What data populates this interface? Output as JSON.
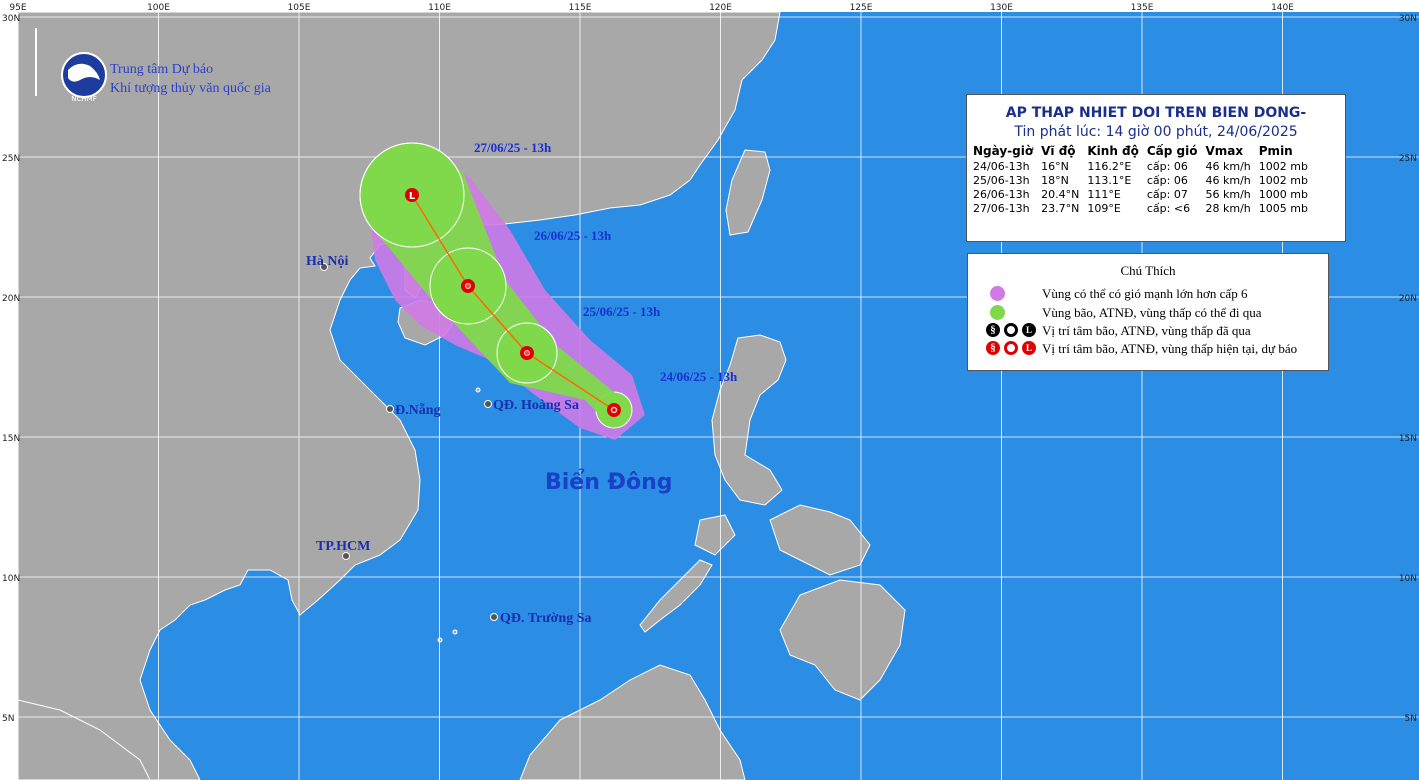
{
  "map": {
    "colors": {
      "sea": "#2b8de3",
      "land": "#a8a8a8",
      "land_border": "#ffffff",
      "grid": "#ffffff",
      "track": "#ff6a00",
      "cone": "#d07ae6",
      "storm_area": "#7fd94a",
      "center": "#e10000"
    },
    "lon_ticks": [
      "95E",
      "100E",
      "105E",
      "110E",
      "115E",
      "120E",
      "125E",
      "130E",
      "135E",
      "140E"
    ],
    "lat_ticks": [
      "30N",
      "25N",
      "20N",
      "15N",
      "10N",
      "5N"
    ],
    "agency": {
      "line1": "Trung tâm Dự báo",
      "line2": "Khí tượng thủy văn quốc gia",
      "logo_text": "NCHMF",
      "logo_icon": "nchmf-logo-icon"
    },
    "places": [
      {
        "id": "hanoi",
        "label": "Hà Nội"
      },
      {
        "id": "danang",
        "label": "Đ.Nẵng"
      },
      {
        "id": "hoangsa",
        "label": "QĐ. Hoàng Sa"
      },
      {
        "id": "hcm",
        "label": "TP.HCM"
      },
      {
        "id": "truongsa",
        "label": "QĐ. Trường Sa"
      }
    ],
    "sea_label": "Biển Đông",
    "track_labels": [
      "24/06/25 - 13h",
      "25/06/25 - 13h",
      "26/06/25 - 13h",
      "27/06/25 - 13h"
    ],
    "final_symbol": "L"
  },
  "info": {
    "title": "AP THAP NHIET DOI TREN BIEN DONG-",
    "issued": "Tin phát lúc: 14 giờ 00 phút, 24/06/2025",
    "headers": [
      "Ngày-giờ",
      "Vĩ độ",
      "Kinh độ",
      "Cấp gió",
      "Vmax",
      "Pmin"
    ],
    "rows": [
      [
        "24/06-13h",
        "16°N",
        "116.2°E",
        "cấp: 06",
        "46 km/h",
        "1002 mb"
      ],
      [
        "25/06-13h",
        "18°N",
        "113.1°E",
        "cấp: 06",
        "46 km/h",
        "1002 mb"
      ],
      [
        "26/06-13h",
        "20.4°N",
        "111°E",
        "cấp: 07",
        "56 km/h",
        "1000 mb"
      ],
      [
        "27/06-13h",
        "23.7°N",
        "109°E",
        "cấp: <6",
        "28 km/h",
        "1005 mb"
      ]
    ]
  },
  "legend": {
    "title": "Chú Thích",
    "items": [
      {
        "text": "Vùng có thể có gió mạnh lớn hơn cấp 6",
        "color": "#d07ae6"
      },
      {
        "text": "Vùng bão, ATNĐ, vùng thấp có thể đi qua",
        "color": "#7fd94a"
      },
      {
        "text": "Vị trí tâm bão, ATNĐ, vùng thấp đã qua",
        "color": "#000000"
      },
      {
        "text": "Vị trí tâm bão, ATNĐ, vùng thấp hiện tại, dự báo",
        "color": "#e10000"
      }
    ],
    "symbol_letters": [
      "O",
      "L"
    ]
  }
}
